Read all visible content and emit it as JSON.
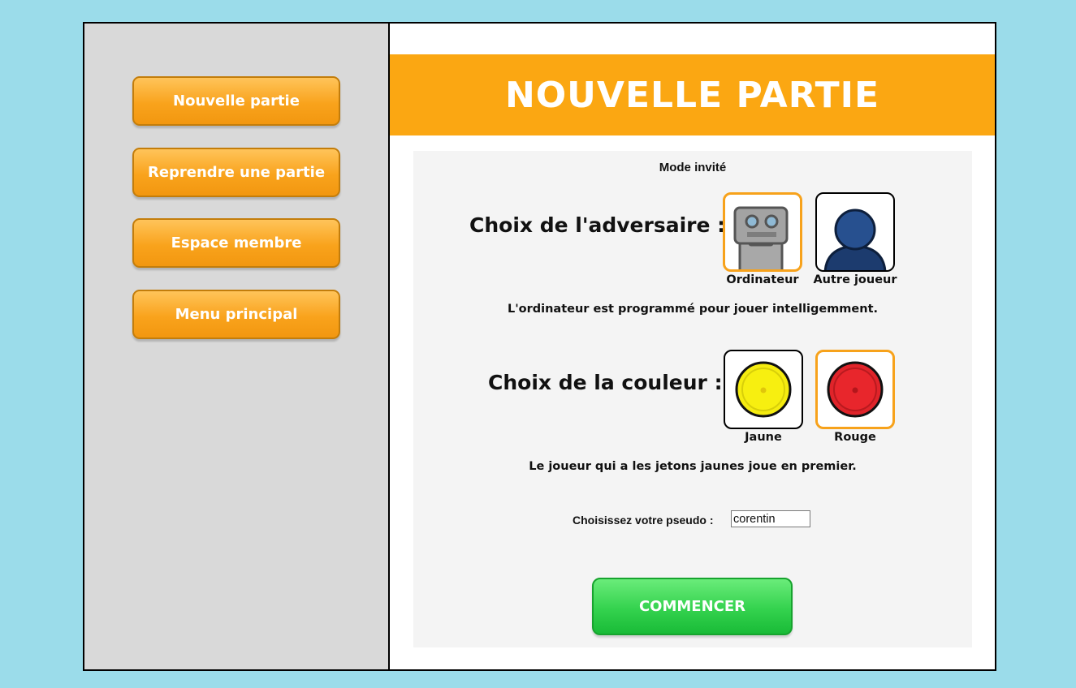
{
  "sidebar": {
    "items": [
      {
        "label": "Nouvelle partie"
      },
      {
        "label": "Reprendre une partie"
      },
      {
        "label": "Espace membre"
      },
      {
        "label": "Menu principal"
      }
    ]
  },
  "header": {
    "title": "NOUVELLE PARTIE"
  },
  "panel": {
    "mode": "Mode invité",
    "opponent": {
      "label": "Choix de l'adversaire :",
      "options": [
        {
          "label": "Ordinateur",
          "icon": "robot-icon",
          "selected": true
        },
        {
          "label": "Autre joueur",
          "icon": "person-icon",
          "selected": false
        }
      ],
      "hint": "L'ordinateur est programmé pour jouer intelligemment."
    },
    "color": {
      "label": "Choix de la couleur :",
      "options": [
        {
          "label": "Jaune",
          "icon": "yellow-token-icon",
          "selected": false,
          "color": "#f7ef10"
        },
        {
          "label": "Rouge",
          "icon": "red-token-icon",
          "selected": true,
          "color": "#e0242a"
        }
      ],
      "hint": "Le joueur qui a les jetons jaunes joue en premier."
    },
    "pseudo": {
      "label": "Choisissez votre pseudo :",
      "value": "corentin"
    },
    "start_label": "COMMENCER"
  },
  "colors": {
    "background": "#9bdcea",
    "accent": "#fba712",
    "sidebar": "#d9d9d9",
    "start": "#34d24e"
  }
}
